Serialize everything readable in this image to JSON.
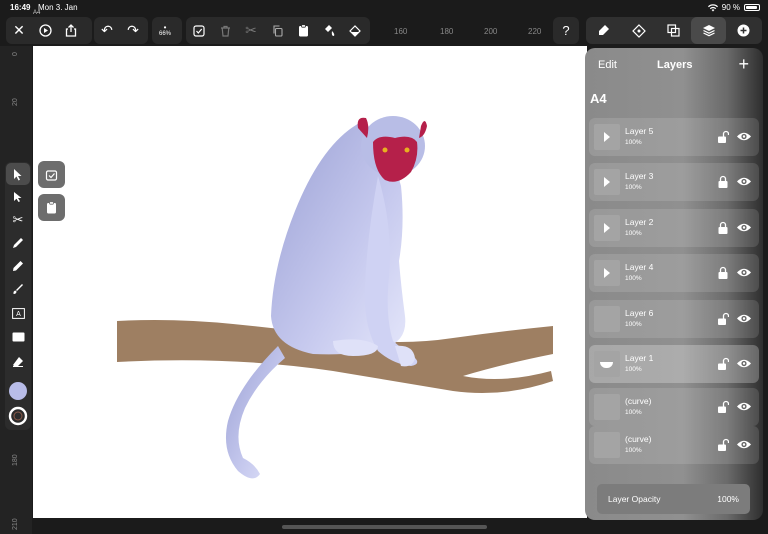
{
  "status": {
    "time": "16:49",
    "date": "Mon 3. Jan",
    "doc_tab": "A4",
    "battery": "90 %",
    "battery_fraction": 0.9
  },
  "toolbar": {
    "zoom": "66%"
  },
  "ruler_top": [
    "160",
    "180",
    "200",
    "220"
  ],
  "ruler_left": [
    "0",
    "20",
    "180",
    "210"
  ],
  "panel": {
    "edit_label": "Edit",
    "title": "Layers",
    "doc_name": "A4",
    "layers": [
      {
        "name": "Layer 5",
        "opacity": "100%",
        "thumb": "tri",
        "lock": "open"
      },
      {
        "name": "Layer 3",
        "opacity": "100%",
        "thumb": "tri",
        "lock": "closed"
      },
      {
        "name": "Layer 2",
        "opacity": "100%",
        "thumb": "tri",
        "lock": "closed"
      },
      {
        "name": "Layer 4",
        "opacity": "100%",
        "thumb": "tri",
        "lock": "closed"
      },
      {
        "name": "Layer 6",
        "opacity": "100%",
        "thumb": "blank",
        "lock": "open"
      },
      {
        "name": "Layer 1",
        "opacity": "100%",
        "thumb": "bowl",
        "lock": "open",
        "selected": true
      },
      {
        "name": "(curve)",
        "opacity": "100%",
        "thumb": "blank",
        "lock": "open"
      },
      {
        "name": "(curve)",
        "opacity": "100%",
        "thumb": "blank",
        "lock": "open"
      }
    ],
    "opacity_label": "Layer Opacity",
    "opacity_value": "100%"
  },
  "colors": {
    "branch": "#9e7f62",
    "monkey_fur": "#b8bde6",
    "monkey_face": "#b5204a",
    "fill_swatch": "#b8bce8"
  }
}
